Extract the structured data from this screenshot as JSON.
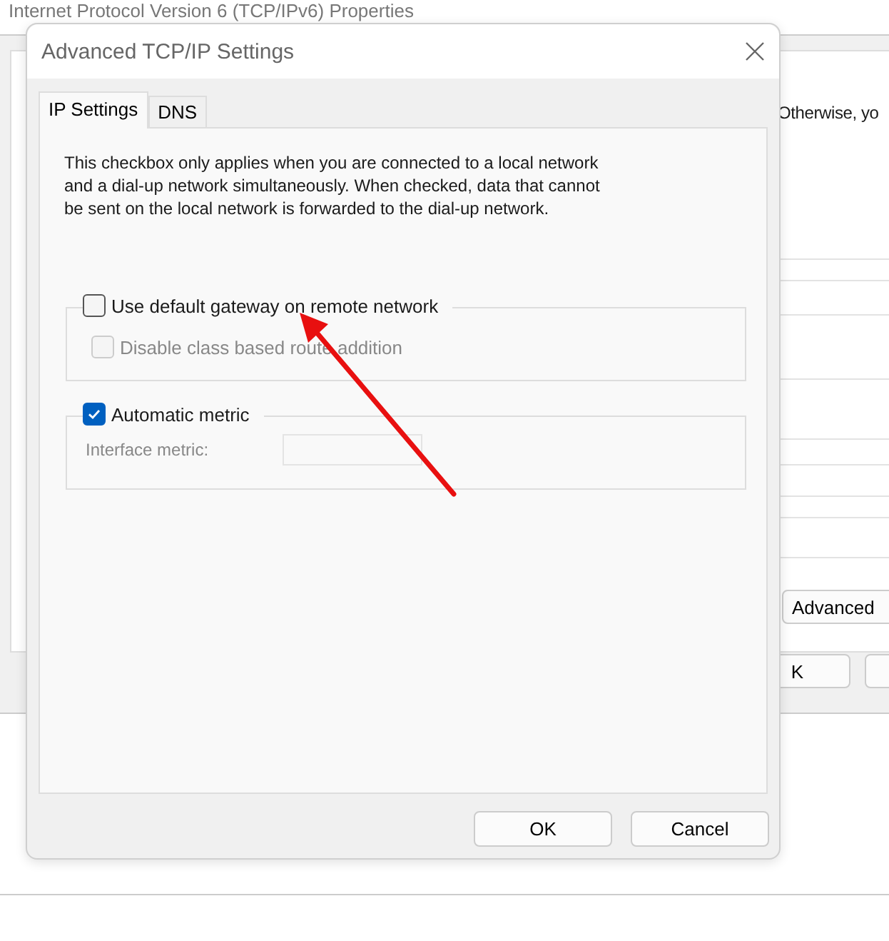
{
  "background_window": {
    "title": "Internet Protocol Version 6 (TCP/IPv6) Properties",
    "text": "Otherwise, yo",
    "buttons": [
      {
        "label": "Advanced"
      },
      {
        "label": "K"
      }
    ]
  },
  "dialog": {
    "title": "Advanced TCP/IP Settings",
    "tabs": [
      {
        "label": "IP Settings",
        "selected": true
      },
      {
        "label": "DNS",
        "selected": false
      }
    ],
    "description": "This checkbox only applies when you are connected to a local network and a dial-up network simultaneously.  When checked, data that cannot be sent on the local network is forwarded to the dial-up network.",
    "groups": [
      {
        "label": "Use default gateway on remote network",
        "checked": false,
        "disabled": false,
        "options": [
          {
            "kind": "checkbox",
            "label": "Disable class based route addition",
            "checked": false,
            "disabled": true
          }
        ]
      },
      {
        "label": "Automatic metric",
        "checked": true,
        "disabled": false,
        "options": [
          {
            "kind": "field",
            "label": "Interface metric:",
            "disabled": true
          }
        ]
      }
    ],
    "buttons": [
      {
        "label": "OK"
      },
      {
        "label": "Cancel"
      }
    ]
  }
}
